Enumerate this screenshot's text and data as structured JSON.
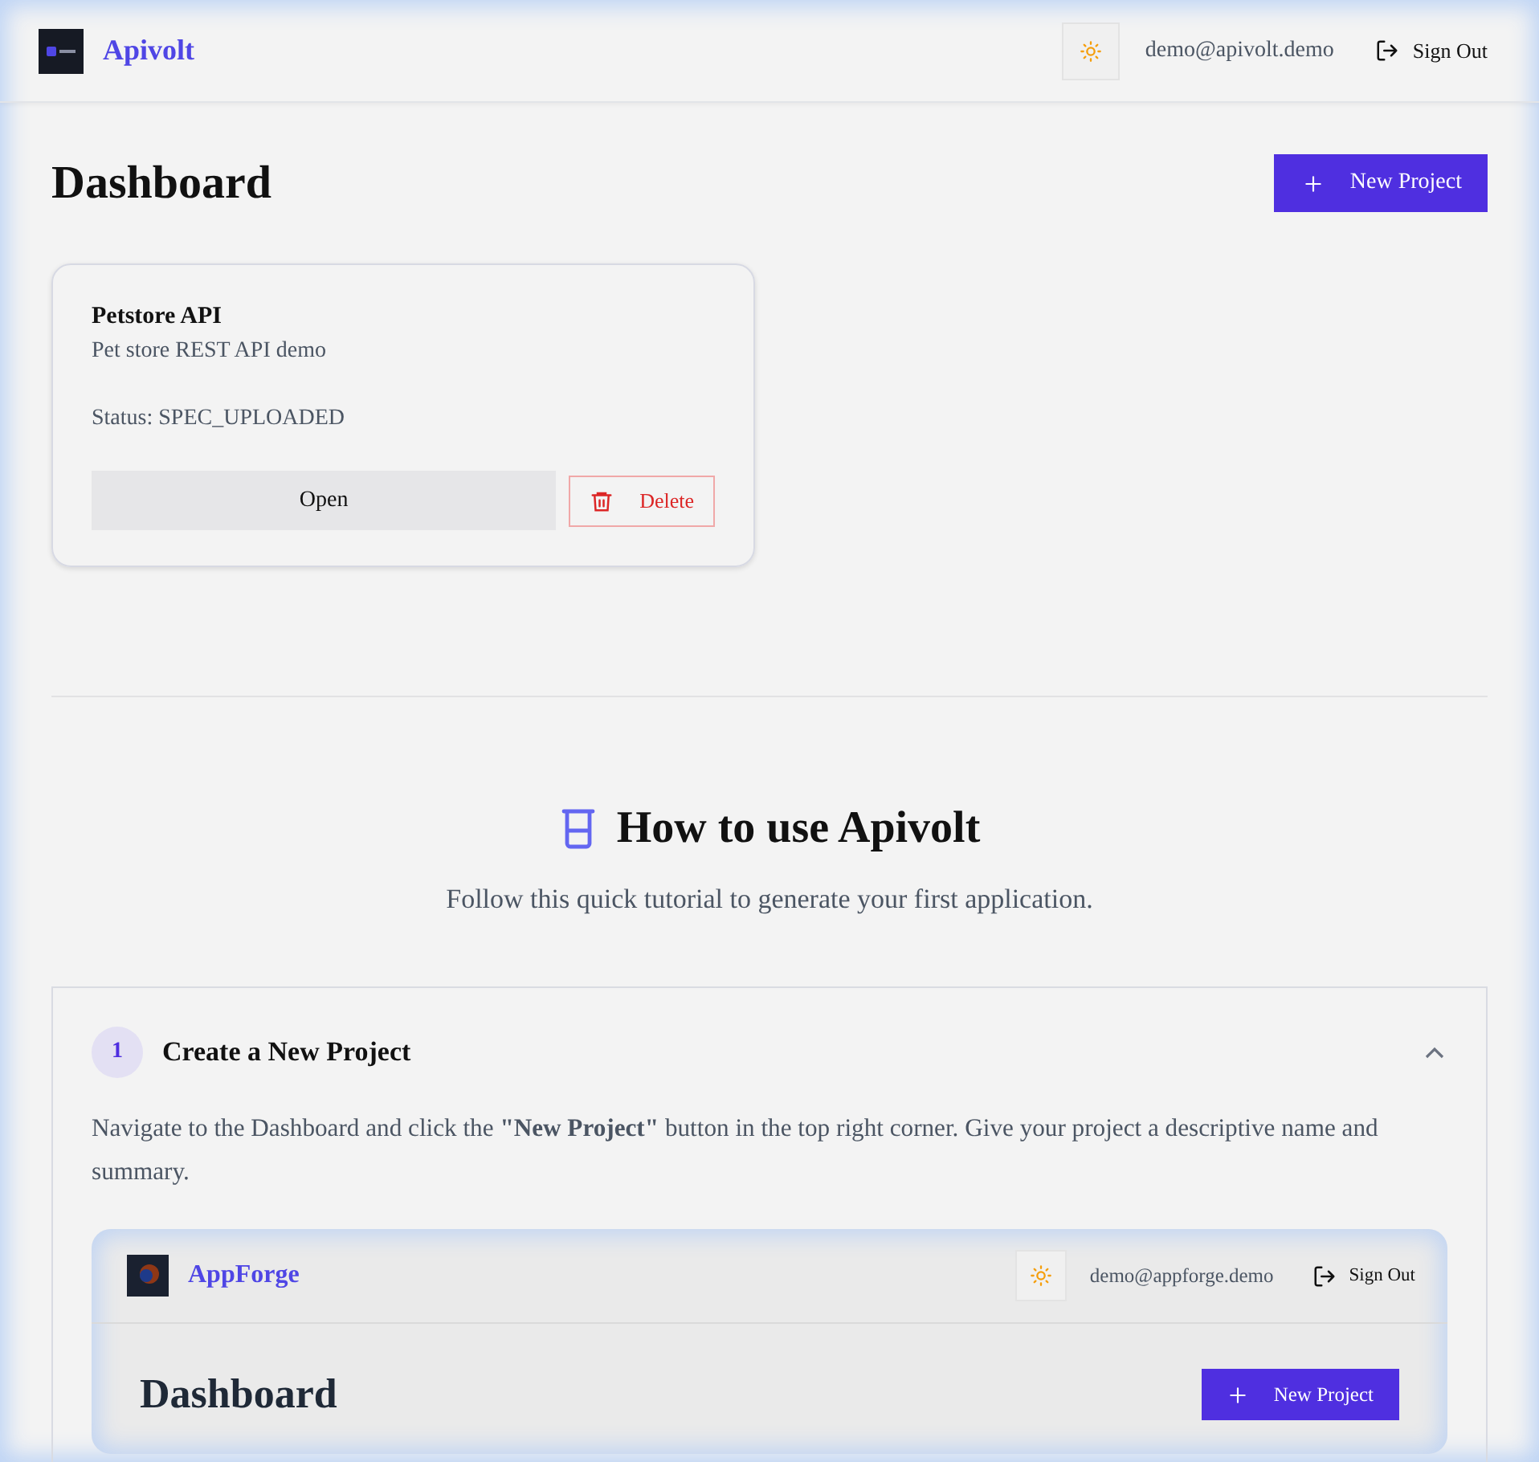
{
  "header": {
    "brand": "Apivolt",
    "user_email": "demo@apivolt.demo",
    "sign_out": "Sign Out"
  },
  "page": {
    "title": "Dashboard",
    "new_project_button": "New Project"
  },
  "projects": [
    {
      "name": "Petstore API",
      "description": "Pet store REST API demo",
      "status": "Status: SPEC_UPLOADED",
      "open_button": "Open",
      "delete_button": "Delete"
    }
  ],
  "tutorial": {
    "title": "How to use Apivolt",
    "subtitle": "Follow this quick tutorial to generate your first application.",
    "steps": [
      {
        "number": "1",
        "title": "Create a New Project",
        "expanded": true,
        "body": "Navigate to the Dashboard and click the **\"New Project\"** button in the top right corner. Give your project a descriptive name and summary.",
        "preview": {
          "brand": "AppForge",
          "user_email": "demo@appforge.demo",
          "sign_out": "Sign Out",
          "title": "Dashboard",
          "new_project_button": "New Project"
        }
      }
    ]
  }
}
